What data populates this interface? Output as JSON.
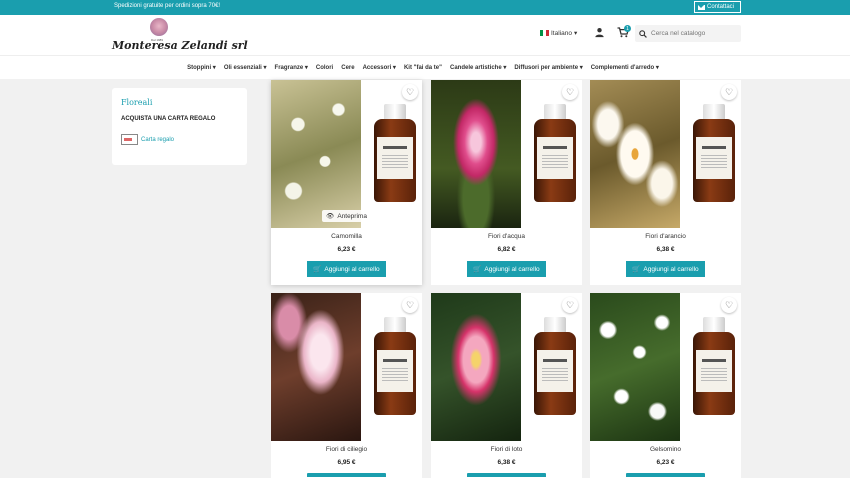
{
  "topbar": {
    "promo": "Spedizioni gratuite per ordini sopra 70€!",
    "contact_label": "Contattaci"
  },
  "header": {
    "logo_small": "Dal 1989",
    "logo_text": "Monteresa Zelandi srl",
    "language": "Italiano",
    "cart_count": "1",
    "search_placeholder": "Cerca nel catalogo"
  },
  "nav": {
    "items": [
      {
        "label": "Stoppini ▾"
      },
      {
        "label": "Oli essenziali ▾"
      },
      {
        "label": "Fragranze ▾"
      },
      {
        "label": "Colori"
      },
      {
        "label": "Cere"
      },
      {
        "label": "Accessori ▾"
      },
      {
        "label": "Kit \"fai da te\""
      },
      {
        "label": "Candele artistiche ▾"
      },
      {
        "label": "Diffusori per ambiente ▾"
      },
      {
        "label": "Complementi d'arredo ▾"
      }
    ]
  },
  "sidebar": {
    "title": "Floreali",
    "gift_heading": "ACQUISTA UNA CARTA REGALO",
    "gift_link": "Carta regalo"
  },
  "products": [
    {
      "name": "Camomilla",
      "price": "6,23 €",
      "button": "Aggiungi al carrello",
      "preview": "Anteprima"
    },
    {
      "name": "Fiori d'acqua",
      "price": "6,82 €",
      "button": "Aggiungi al carrello"
    },
    {
      "name": "Fiori d'arancio",
      "price": "6,38 €",
      "button": "Aggiungi al carrello"
    },
    {
      "name": "Fiori di ciliegio",
      "price": "6,95 €"
    },
    {
      "name": "Fiori di loto",
      "price": "6,38 €"
    },
    {
      "name": "Gelsomino",
      "price": "6,23 €"
    }
  ],
  "colors": {
    "accent": "#1a9eae",
    "background": "#f1f1f1"
  },
  "icons": [
    "envelope-icon",
    "user-icon",
    "cart-icon",
    "search-icon",
    "heart-icon",
    "eye-icon",
    "gift-card-icon"
  ]
}
